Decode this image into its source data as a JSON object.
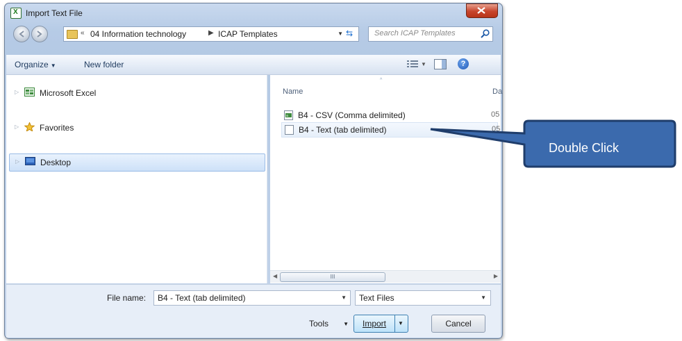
{
  "window": {
    "title": "Import Text File"
  },
  "address": {
    "crumbs": [
      "04 Information technology",
      "ICAP Templates"
    ],
    "search_placeholder": "Search ICAP Templates"
  },
  "toolbar": {
    "organize": "Organize",
    "new_folder": "New folder"
  },
  "nav": {
    "items": [
      {
        "label": "Microsoft Excel",
        "icon": "excel-icon"
      },
      {
        "label": "Favorites",
        "icon": "star-icon"
      },
      {
        "label": "Desktop",
        "icon": "desktop-icon",
        "selected": true
      }
    ]
  },
  "files": {
    "col_name": "Name",
    "col_date": "Da",
    "rows": [
      {
        "name": "B4 - CSV (Comma delimited)",
        "date": "05",
        "icon": "csv-file-icon"
      },
      {
        "name": "B4 - Text (tab delimited)",
        "date": "05",
        "icon": "text-file-icon"
      }
    ]
  },
  "scrollbar": {
    "thumb_grip": "III"
  },
  "bottom": {
    "file_name_label": "File name:",
    "file_name_value": "B4 - Text (tab delimited)",
    "file_type": "Text Files",
    "tools_label": "Tools",
    "import_label": "Import",
    "cancel_label": "Cancel"
  },
  "callout": {
    "text": "Double Click",
    "fill": "#3b6aad",
    "stroke": "#1f3d6b"
  }
}
